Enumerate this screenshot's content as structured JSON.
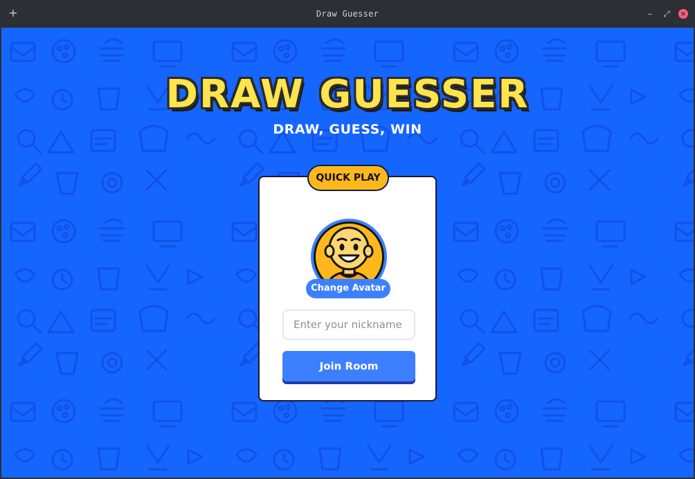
{
  "window": {
    "title": "Draw Guesser",
    "add_icon": "+",
    "minimize_icon": "–",
    "restore_icon": "⤢",
    "close_icon": "×"
  },
  "page": {
    "logo_text": "DRAW GUESSER",
    "tagline": "DRAW, GUESS, WIN"
  },
  "card": {
    "badge": "QUICK PLAY",
    "change_avatar_label": "Change Avatar",
    "nickname_placeholder": "Enter your nickname",
    "join_label": "Join Room"
  },
  "colors": {
    "background": "#1565ff",
    "logo_fill": "#ffe44d",
    "badge": "#ffb81c",
    "primary_button": "#3d80ff"
  },
  "icons": {
    "avatar": "smiling-bald-character-icon",
    "pattern": "doodle-pattern"
  }
}
